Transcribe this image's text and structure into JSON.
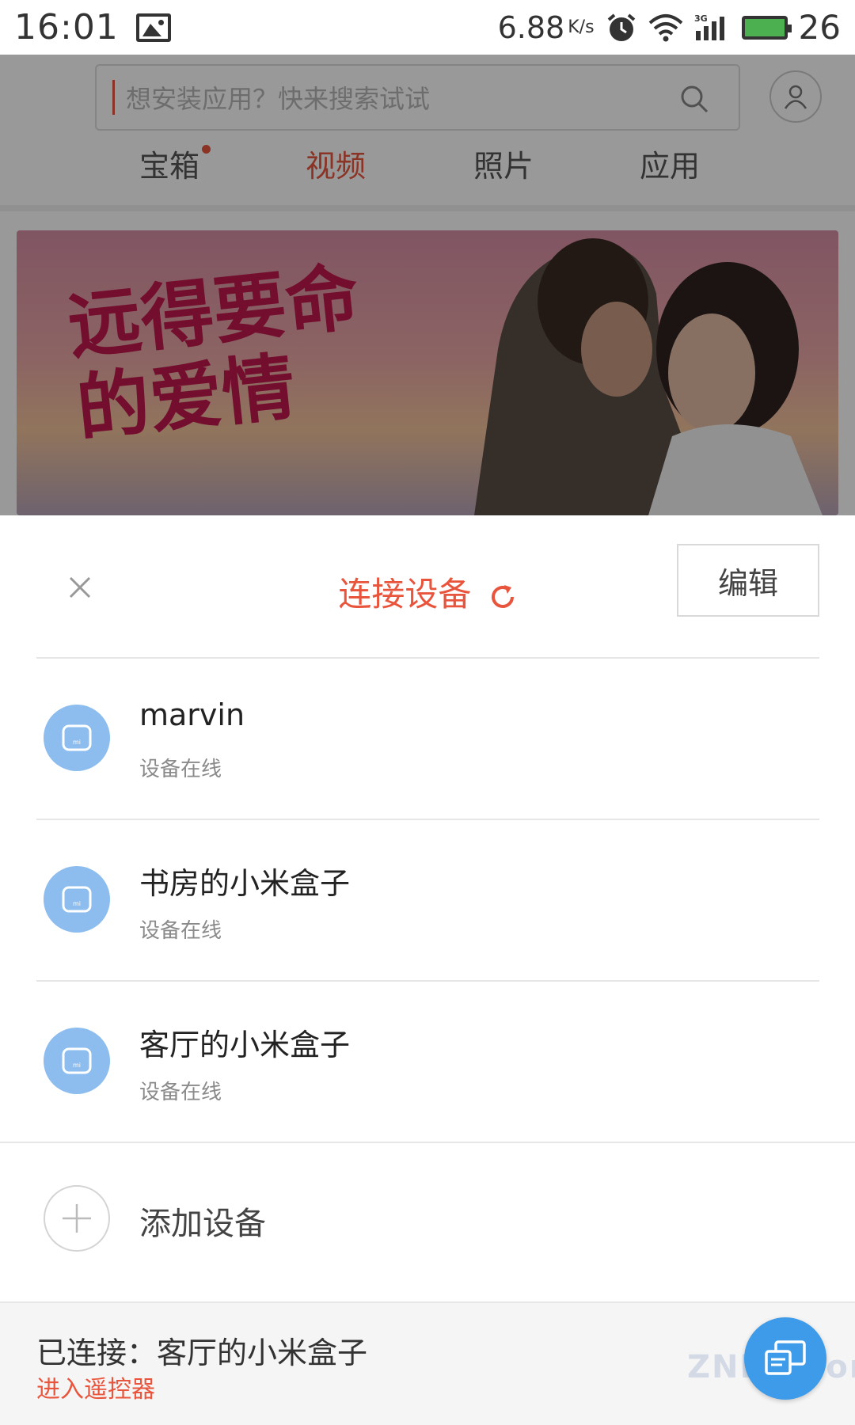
{
  "status_bar": {
    "time": "16:01",
    "net_speed": "6.88",
    "net_unit": "K/s",
    "network_type": "3G",
    "battery_level": "26"
  },
  "background_app": {
    "search_placeholder": "想安装应用？快来搜索试试",
    "tabs": [
      {
        "label": "宝箱",
        "has_dot": true
      },
      {
        "label": "视频",
        "active": true
      },
      {
        "label": "照片"
      },
      {
        "label": "应用"
      }
    ],
    "banner_title": "远得要命的爱情"
  },
  "sheet": {
    "title": "连接设备",
    "edit_label": "编辑",
    "devices": [
      {
        "name": "marvin",
        "status": "设备在线"
      },
      {
        "name": "书房的小米盒子",
        "status": "设备在线"
      },
      {
        "name": "客厅的小米盒子",
        "status": "设备在线"
      }
    ],
    "add_device_label": "添加设备",
    "connected_text": "已连接：客厅的小米盒子",
    "remote_link": "进入遥控器"
  },
  "watermark": "ZNDS.com",
  "colors": {
    "accent": "#e8553c",
    "device_icon_bg": "#8cbdee",
    "fab_bg": "#3d9be9"
  }
}
